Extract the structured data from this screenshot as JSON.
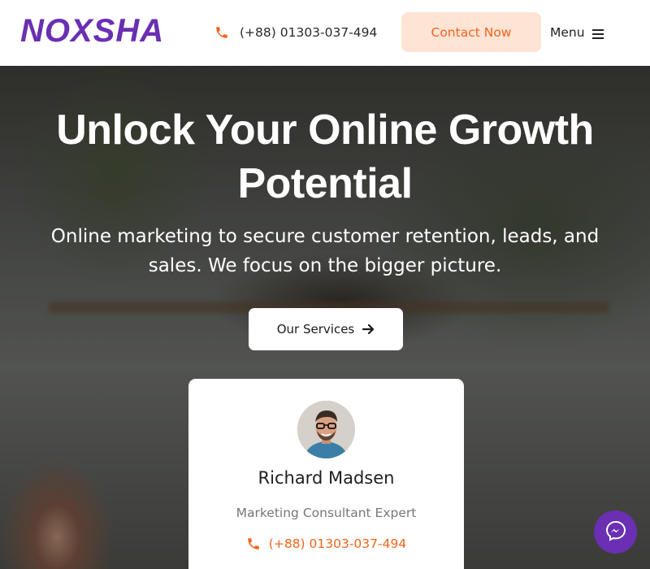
{
  "header": {
    "logo_text": "NOXSHA",
    "phone": "(+88) 01303-037-494",
    "contact_label": "Contact Now",
    "menu_label": "Menu"
  },
  "hero": {
    "title": "Unlock Your Online Growth Potential",
    "subtitle": "Online marketing to secure customer retention, leads, and sales. We focus on the bigger picture.",
    "services_label": "Our Services"
  },
  "card": {
    "name": "Richard Madsen",
    "role": "Marketing Consultant Expert",
    "phone": "(+88) 01303-037-494"
  },
  "icons": {
    "phone": "phone-icon",
    "menu": "hamburger-icon",
    "arrow": "arrow-right-icon",
    "messenger": "messenger-icon"
  },
  "colors": {
    "brand_purple": "#6a2fb2",
    "accent_orange": "#f0641e",
    "contact_bg": "#fde4d5"
  }
}
